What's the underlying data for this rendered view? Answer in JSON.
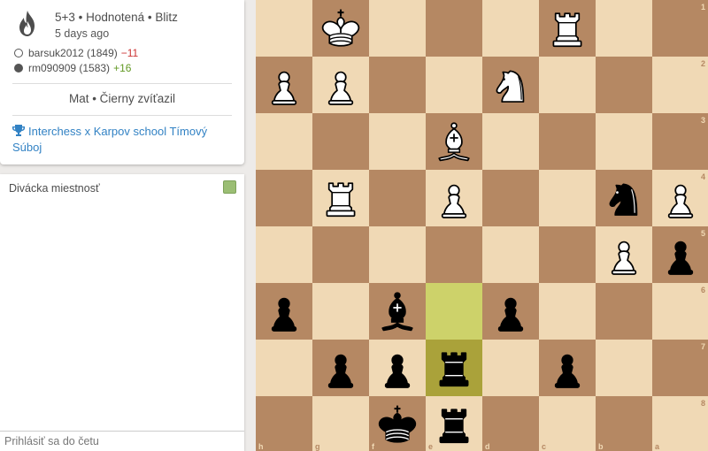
{
  "game": {
    "title": "5+3 • Hodnotená • Blitz",
    "time_ago": "5 days ago",
    "players": [
      {
        "name": "barsuk2012 (1849)",
        "delta": "−11",
        "color": "white"
      },
      {
        "name": "rm090909 (1583)",
        "delta": "+16",
        "color": "black"
      }
    ],
    "result": "Mat • Čierny zvíťazil",
    "tournament": "Interchess x Karpov school Tímový Súboj"
  },
  "chat": {
    "header": "Divácka miestnosť",
    "placeholder": "Prihlásiť sa do četu"
  },
  "board": {
    "files": [
      "h",
      "g",
      "f",
      "e",
      "d",
      "c",
      "b",
      "a"
    ],
    "ranks": [
      "1",
      "2",
      "3",
      "4",
      "5",
      "6",
      "7",
      "8"
    ],
    "highlight": [
      [
        3,
        5
      ],
      [
        3,
        6
      ]
    ],
    "pieces": [
      {
        "row": 0,
        "col": 1,
        "color": "w",
        "type": "K",
        "name": "white-king"
      },
      {
        "row": 0,
        "col": 5,
        "color": "w",
        "type": "R",
        "name": "white-rook"
      },
      {
        "row": 1,
        "col": 0,
        "color": "w",
        "type": "P",
        "name": "white-pawn"
      },
      {
        "row": 1,
        "col": 1,
        "color": "w",
        "type": "P",
        "name": "white-pawn"
      },
      {
        "row": 1,
        "col": 4,
        "color": "w",
        "type": "N",
        "name": "white-knight"
      },
      {
        "row": 2,
        "col": 3,
        "color": "w",
        "type": "B",
        "name": "white-bishop"
      },
      {
        "row": 3,
        "col": 1,
        "color": "w",
        "type": "R",
        "name": "white-rook"
      },
      {
        "row": 3,
        "col": 3,
        "color": "w",
        "type": "P",
        "name": "white-pawn"
      },
      {
        "row": 3,
        "col": 6,
        "color": "b",
        "type": "N",
        "name": "black-knight"
      },
      {
        "row": 3,
        "col": 7,
        "color": "w",
        "type": "P",
        "name": "white-pawn"
      },
      {
        "row": 4,
        "col": 6,
        "color": "w",
        "type": "P",
        "name": "white-pawn"
      },
      {
        "row": 4,
        "col": 7,
        "color": "b",
        "type": "P",
        "name": "black-pawn"
      },
      {
        "row": 5,
        "col": 0,
        "color": "b",
        "type": "P",
        "name": "black-pawn"
      },
      {
        "row": 5,
        "col": 2,
        "color": "b",
        "type": "B",
        "name": "black-bishop"
      },
      {
        "row": 5,
        "col": 4,
        "color": "b",
        "type": "P",
        "name": "black-pawn"
      },
      {
        "row": 6,
        "col": 1,
        "color": "b",
        "type": "P",
        "name": "black-pawn"
      },
      {
        "row": 6,
        "col": 2,
        "color": "b",
        "type": "P",
        "name": "black-pawn"
      },
      {
        "row": 6,
        "col": 3,
        "color": "b",
        "type": "R",
        "name": "black-rook"
      },
      {
        "row": 6,
        "col": 5,
        "color": "b",
        "type": "P",
        "name": "black-pawn"
      },
      {
        "row": 7,
        "col": 2,
        "color": "b",
        "type": "K",
        "name": "black-king"
      },
      {
        "row": 7,
        "col": 3,
        "color": "b",
        "type": "R",
        "name": "black-rook"
      }
    ]
  },
  "colors": {
    "light_square": "#f0d9b5",
    "dark_square": "#b58863",
    "highlight_light": "#cdd26a",
    "highlight_dark": "#aaa23a",
    "link": "#3282c4",
    "rating_loss": "#cc3333",
    "rating_gain": "#629924"
  }
}
